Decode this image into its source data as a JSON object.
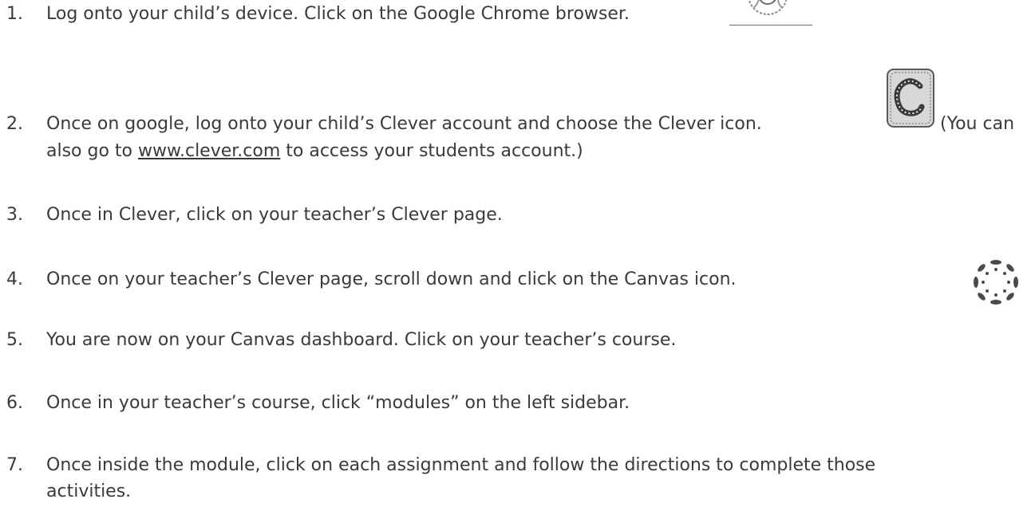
{
  "steps": [
    {
      "number": "1.",
      "text": "Log onto your child’s device. Click on the Google Chrome browser."
    },
    {
      "number": "2.",
      "text_before_icon": "Once on google, log onto your child’s Clever account and choose the Clever icon.",
      "text_after_icon": "(You can",
      "line2_pre": "also go to ",
      "link": "www.clever.com",
      "line2_post": " to access your students account.)"
    },
    {
      "number": "3.",
      "text": "Once in Clever, click on your teacher’s Clever page."
    },
    {
      "number": "4.",
      "text": "Once on your teacher’s Clever page, scroll down and click on the Canvas icon."
    },
    {
      "number": "5.",
      "text": "You are now on your Canvas dashboard. Click on your teacher’s course."
    },
    {
      "number": "6.",
      "text": "Once in your teacher’s course, click “modules” on the left sidebar."
    },
    {
      "number": "7.",
      "text_line1": "Once inside the module, click on each assignment and follow the directions to complete those",
      "text_line2": "activities."
    }
  ],
  "icons": {
    "chrome": "chrome-icon",
    "clever": "clever-icon",
    "canvas": "canvas-icon"
  }
}
